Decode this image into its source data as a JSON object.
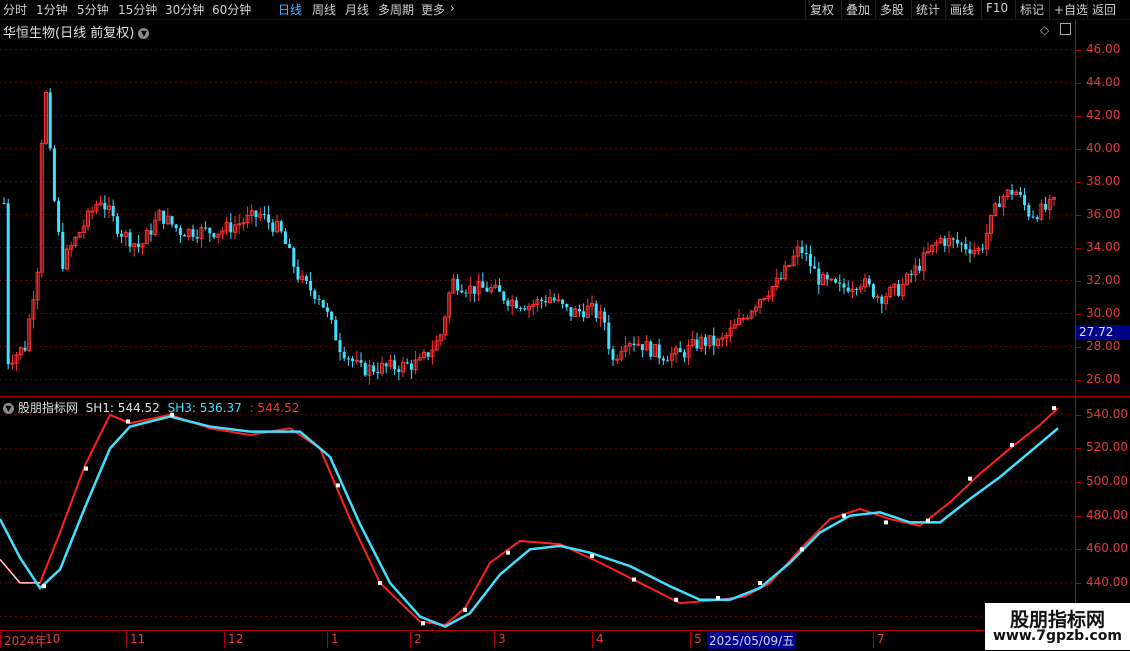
{
  "toolbar": {
    "periods": [
      "分时",
      "1分钟",
      "5分钟",
      "15分钟",
      "30分钟",
      "60分钟",
      "日线",
      "周线",
      "月线",
      "多周期",
      "更多"
    ],
    "active_period": "日线",
    "more_arrow": "›",
    "right_buttons": [
      "复权",
      "叠加",
      "多股",
      "统计",
      "画线",
      "F10",
      "标记",
      "+自选",
      "返回"
    ]
  },
  "main_chart": {
    "title": "华恒生物(日线 前复权)",
    "title_icon": "chevron-down-icon",
    "corner_icons": [
      "diamond-icon",
      "panel-icon"
    ],
    "y_ticks": [
      "46.00",
      "44.00",
      "42.00",
      "40.00",
      "38.00",
      "36.00",
      "34.00",
      "32.00",
      "30.00",
      "28.00",
      "26.00"
    ],
    "y_range": [
      25.0,
      47.8
    ],
    "current_price_tag": "27.72",
    "colors": {
      "up": "#ff3030",
      "down": "#40e0ff",
      "grid": "#6a0000"
    }
  },
  "indicator": {
    "name": "股朋指标网",
    "sh1_label": "SH1: 544.52",
    "sh3_label": "SH3: 536.37",
    "extra_label": ": 544.52",
    "y_ticks": [
      "540.00",
      "520.00",
      "500.00",
      "480.00",
      "460.00",
      "440.00",
      "420.00"
    ],
    "y_range": [
      412,
      550
    ],
    "colors": {
      "sh1_up": "#ff2020",
      "sh1_down": "#ffffff",
      "sh3": "#40e0ff"
    }
  },
  "x_axis": {
    "ticks": [
      {
        "label": "2024年",
        "x": 0
      },
      {
        "label": "10",
        "x": 41
      },
      {
        "label": "11",
        "x": 126
      },
      {
        "label": "12",
        "x": 224
      },
      {
        "label": "1",
        "x": 327
      },
      {
        "label": "2",
        "x": 410
      },
      {
        "label": "3",
        "x": 494
      },
      {
        "label": "4",
        "x": 592
      },
      {
        "label": "5",
        "x": 690
      },
      {
        "label": "7",
        "x": 873
      }
    ],
    "cursor_date": "2025/05/09/五"
  },
  "watermark": {
    "title": "股朋指标网",
    "url": "www.7gpzb.com"
  }
}
